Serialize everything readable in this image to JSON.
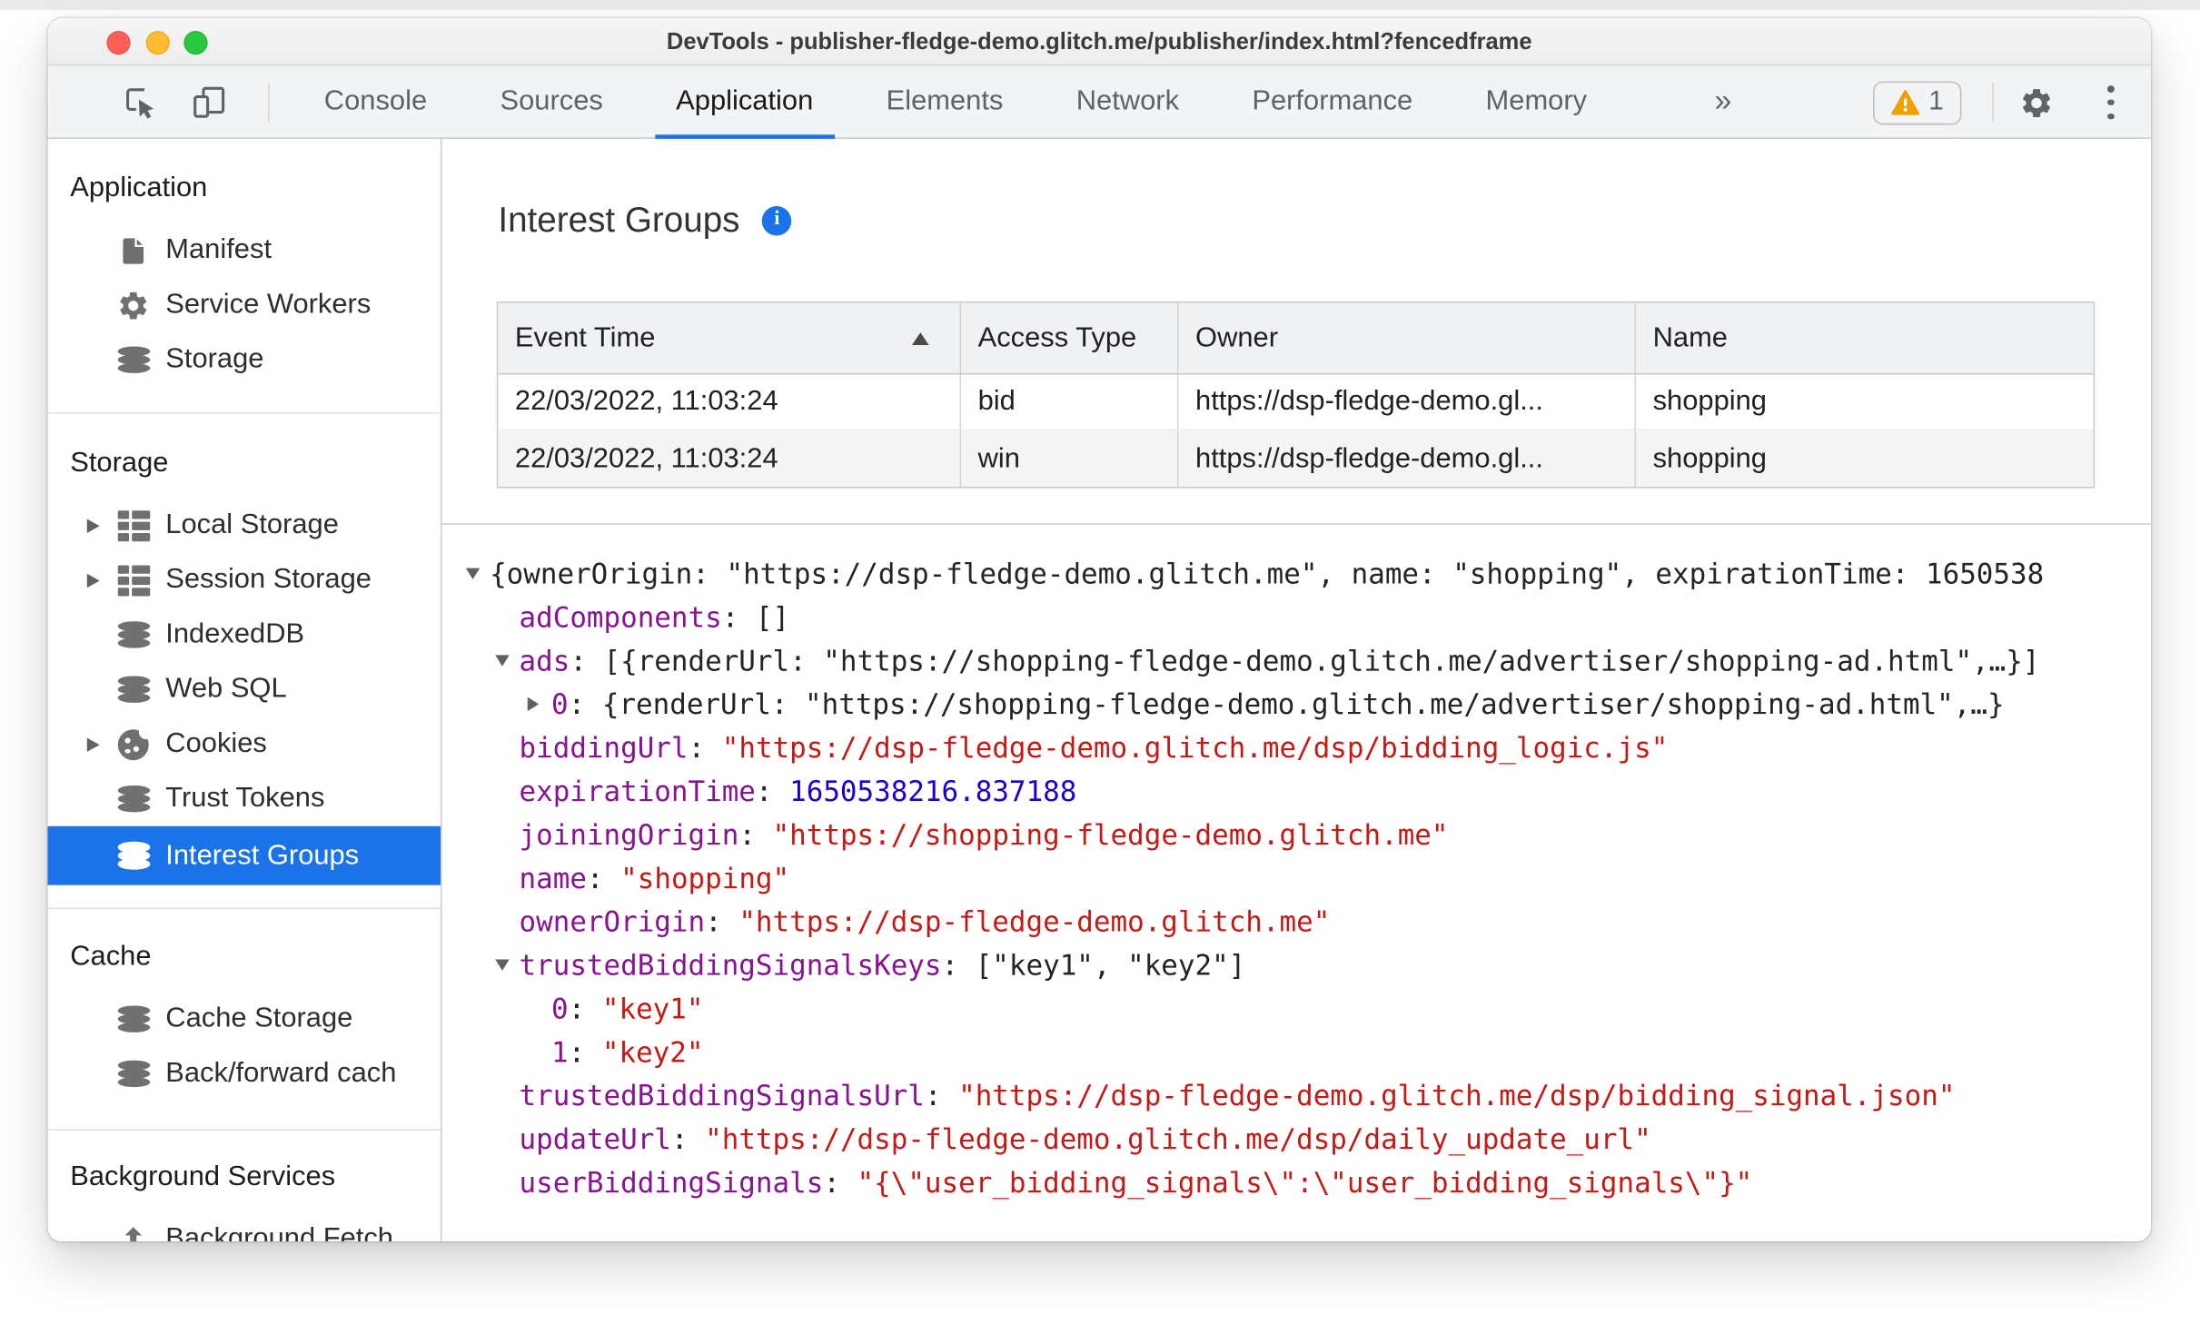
{
  "window": {
    "title": "DevTools - publisher-fledge-demo.glitch.me/publisher/index.html?fencedframe"
  },
  "toolbar": {
    "tabs": [
      {
        "label": "Console",
        "active": false
      },
      {
        "label": "Sources",
        "active": false
      },
      {
        "label": "Application",
        "active": true
      },
      {
        "label": "Elements",
        "active": false
      },
      {
        "label": "Network",
        "active": false
      },
      {
        "label": "Performance",
        "active": false
      },
      {
        "label": "Memory",
        "active": false
      }
    ],
    "more_tabs_label": "»",
    "warning_count": "1"
  },
  "sidebar": {
    "sections": [
      {
        "header": "Application",
        "items": [
          {
            "label": "Manifest",
            "icon": "document-icon",
            "expander": false,
            "selected": false
          },
          {
            "label": "Service Workers",
            "icon": "gear-icon",
            "expander": false,
            "selected": false
          },
          {
            "label": "Storage",
            "icon": "database-icon",
            "expander": false,
            "selected": false
          }
        ]
      },
      {
        "header": "Storage",
        "items": [
          {
            "label": "Local Storage",
            "icon": "table-icon",
            "expander": true,
            "selected": false
          },
          {
            "label": "Session Storage",
            "icon": "table-icon",
            "expander": true,
            "selected": false
          },
          {
            "label": "IndexedDB",
            "icon": "database-icon",
            "expander": false,
            "selected": false
          },
          {
            "label": "Web SQL",
            "icon": "database-icon",
            "expander": false,
            "selected": false
          },
          {
            "label": "Cookies",
            "icon": "cookie-icon",
            "expander": true,
            "selected": false
          },
          {
            "label": "Trust Tokens",
            "icon": "database-icon",
            "expander": false,
            "selected": false
          },
          {
            "label": "Interest Groups",
            "icon": "database-icon",
            "expander": false,
            "selected": true
          }
        ]
      },
      {
        "header": "Cache",
        "items": [
          {
            "label": "Cache Storage",
            "icon": "database-icon",
            "expander": false,
            "selected": false
          },
          {
            "label": "Back/forward cach",
            "icon": "database-icon",
            "expander": false,
            "selected": false
          }
        ]
      },
      {
        "header": "Background Services",
        "items": [
          {
            "label": "Background Fetch",
            "icon": "upload-icon",
            "expander": false,
            "selected": false
          }
        ]
      }
    ]
  },
  "main": {
    "title": "Interest Groups",
    "table": {
      "columns": [
        {
          "label": "Event Time",
          "sorted": "asc"
        },
        {
          "label": "Access Type",
          "sorted": null
        },
        {
          "label": "Owner",
          "sorted": null
        },
        {
          "label": "Name",
          "sorted": null
        }
      ],
      "rows": [
        [
          "22/03/2022, 11:03:24",
          "bid",
          "https://dsp-fledge-demo.gl...",
          "shopping"
        ],
        [
          "22/03/2022, 11:03:24",
          "win",
          "https://dsp-fledge-demo.gl...",
          "shopping"
        ]
      ]
    },
    "tree": {
      "lines": [
        {
          "indent": 0,
          "expander": "down",
          "segments": [
            {
              "t": "{ownerOrigin: \"https://dsp-fledge-demo.glitch.me\", name: \"shopping\", expirationTime: 1650538",
              "c": "p"
            }
          ]
        },
        {
          "indent": 1,
          "expander": null,
          "segments": [
            {
              "t": "adComponents",
              "c": "k"
            },
            {
              "t": ": []",
              "c": "p"
            }
          ]
        },
        {
          "indent": 1,
          "expander": "down",
          "segments": [
            {
              "t": "ads",
              "c": "k"
            },
            {
              "t": ": [{renderUrl: \"https://shopping-fledge-demo.glitch.me/advertiser/shopping-ad.html\",…}]",
              "c": "p"
            }
          ]
        },
        {
          "indent": 2,
          "expander": "right",
          "segments": [
            {
              "t": "0",
              "c": "k"
            },
            {
              "t": ": {renderUrl: \"https://shopping-fledge-demo.glitch.me/advertiser/shopping-ad.html\",…}",
              "c": "p"
            }
          ]
        },
        {
          "indent": 1,
          "expander": null,
          "segments": [
            {
              "t": "biddingUrl",
              "c": "k"
            },
            {
              "t": ": ",
              "c": "p"
            },
            {
              "t": "\"https://dsp-fledge-demo.glitch.me/dsp/bidding_logic.js\"",
              "c": "s"
            }
          ]
        },
        {
          "indent": 1,
          "expander": null,
          "segments": [
            {
              "t": "expirationTime",
              "c": "k"
            },
            {
              "t": ": ",
              "c": "p"
            },
            {
              "t": "1650538216.837188",
              "c": "n"
            }
          ]
        },
        {
          "indent": 1,
          "expander": null,
          "segments": [
            {
              "t": "joiningOrigin",
              "c": "k"
            },
            {
              "t": ": ",
              "c": "p"
            },
            {
              "t": "\"https://shopping-fledge-demo.glitch.me\"",
              "c": "s"
            }
          ]
        },
        {
          "indent": 1,
          "expander": null,
          "segments": [
            {
              "t": "name",
              "c": "k"
            },
            {
              "t": ": ",
              "c": "p"
            },
            {
              "t": "\"shopping\"",
              "c": "s"
            }
          ]
        },
        {
          "indent": 1,
          "expander": null,
          "segments": [
            {
              "t": "ownerOrigin",
              "c": "k"
            },
            {
              "t": ": ",
              "c": "p"
            },
            {
              "t": "\"https://dsp-fledge-demo.glitch.me\"",
              "c": "s"
            }
          ]
        },
        {
          "indent": 1,
          "expander": "down",
          "segments": [
            {
              "t": "trustedBiddingSignalsKeys",
              "c": "k"
            },
            {
              "t": ": [\"key1\", \"key2\"]",
              "c": "p"
            }
          ]
        },
        {
          "indent": 2,
          "expander": null,
          "segments": [
            {
              "t": "0",
              "c": "k"
            },
            {
              "t": ": ",
              "c": "p"
            },
            {
              "t": "\"key1\"",
              "c": "s"
            }
          ]
        },
        {
          "indent": 2,
          "expander": null,
          "segments": [
            {
              "t": "1",
              "c": "k"
            },
            {
              "t": ": ",
              "c": "p"
            },
            {
              "t": "\"key2\"",
              "c": "s"
            }
          ]
        },
        {
          "indent": 1,
          "expander": null,
          "segments": [
            {
              "t": "trustedBiddingSignalsUrl",
              "c": "k"
            },
            {
              "t": ": ",
              "c": "p"
            },
            {
              "t": "\"https://dsp-fledge-demo.glitch.me/dsp/bidding_signal.json\"",
              "c": "s"
            }
          ]
        },
        {
          "indent": 1,
          "expander": null,
          "segments": [
            {
              "t": "updateUrl",
              "c": "k"
            },
            {
              "t": ": ",
              "c": "p"
            },
            {
              "t": "\"https://dsp-fledge-demo.glitch.me/dsp/daily_update_url\"",
              "c": "s"
            }
          ]
        },
        {
          "indent": 1,
          "expander": null,
          "segments": [
            {
              "t": "userBiddingSignals",
              "c": "k"
            },
            {
              "t": ": ",
              "c": "p"
            },
            {
              "t": "\"{\\\"user_bidding_signals\\\":\\\"user_bidding_signals\\\"}\"",
              "c": "s"
            }
          ]
        }
      ]
    }
  },
  "colors": {
    "accent_blue": "#1a73e8",
    "selected_row_bg": "#1a73e8",
    "syntax_key": "#881391",
    "syntax_string": "#c41a16",
    "syntax_number": "#1c00cf",
    "warning_yellow": "#f0a000",
    "traffic_red": "#ff5f57",
    "traffic_yellow": "#febc2e",
    "traffic_green": "#28c840"
  }
}
